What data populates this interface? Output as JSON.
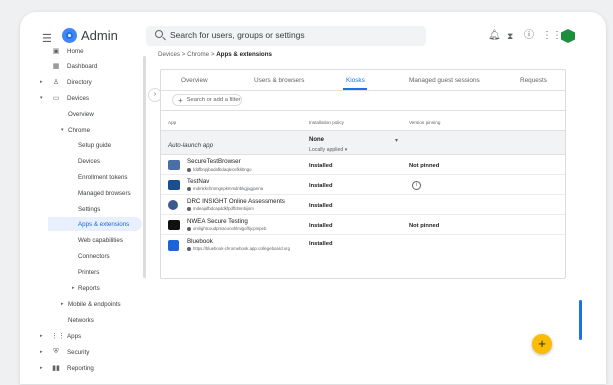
{
  "header": {
    "app_title": "Admin",
    "search_placeholder": "Search for users, groups or settings",
    "icons": [
      "menu-icon",
      "notifications-icon",
      "hourglass-icon",
      "help-icon",
      "apps-grid-icon",
      "admin-badge-icon"
    ]
  },
  "sidebar": {
    "items": [
      {
        "label": "Home",
        "icon": "home-icon"
      },
      {
        "label": "Dashboard",
        "icon": "dashboard-icon"
      },
      {
        "label": "Directory",
        "icon": "directory-icon"
      },
      {
        "label": "Devices",
        "icon": "devices-icon"
      },
      {
        "label": "Overview"
      },
      {
        "label": "Chrome"
      },
      {
        "label": "Setup guide"
      },
      {
        "label": "Devices"
      },
      {
        "label": "Enrollment tokens"
      },
      {
        "label": "Managed browsers"
      },
      {
        "label": "Settings"
      },
      {
        "label": "Apps & extensions"
      },
      {
        "label": "Web capabilities"
      },
      {
        "label": "Connectors"
      },
      {
        "label": "Printers"
      },
      {
        "label": "Reports"
      },
      {
        "label": "Mobile & endpoints"
      },
      {
        "label": "Networks"
      },
      {
        "label": "Apps",
        "icon": "apps-icon"
      },
      {
        "label": "Security",
        "icon": "security-icon"
      },
      {
        "label": "Reporting",
        "icon": "reporting-icon"
      }
    ]
  },
  "breadcrumb": {
    "part1": "Devices",
    "sep": ">",
    "part2": "Chrome",
    "part3": "Apps & extensions"
  },
  "tabs": [
    "Overview",
    "Users & browsers",
    "Kiosks",
    "Managed guest sessions",
    "Requests"
  ],
  "active_tab": "Kiosks",
  "filter_label": "Search or add a filter",
  "table": {
    "headers": [
      "App",
      "Installation policy",
      "Version pinning"
    ],
    "auto_launch": {
      "label": "Auto-launch app",
      "value": "None",
      "sub": "Locally applied"
    },
    "rows": [
      {
        "name": "SecureTestBrowser",
        "id": "fddfbnpjbadafbdaqlecefkkbngo",
        "install": "Installed",
        "pin": "Not pinned",
        "icon_color": "#4a6fa5"
      },
      {
        "name": "TestNav",
        "id": "mdmkkchmmgnpkmmdnbkgjogjanna",
        "install": "Installed",
        "pin": "",
        "icon_color": "#1a4f8f"
      },
      {
        "name": "DRC INSIGHT Online Assessments",
        "id": "mdeajafbdcapddkfpdffdmnbijom",
        "install": "Installed",
        "pin": "",
        "icon_color": "#3b5b8c"
      },
      {
        "name": "NWEA Secure Testing",
        "id": "omlightcoudpmaconohlmigofhjcpmpeb",
        "install": "Installed",
        "pin": "Not pinned",
        "icon_color": "#111111"
      },
      {
        "name": "Bluebook",
        "id": "https://bluebook-chromebook.app.collegeboard.org",
        "install": "Installed",
        "pin": "",
        "icon_color": "#1c64d8"
      }
    ]
  },
  "colors": {
    "accent": "#1a73e8",
    "fab": "#fbbc04",
    "admin_badge": "#1e8e3e"
  }
}
